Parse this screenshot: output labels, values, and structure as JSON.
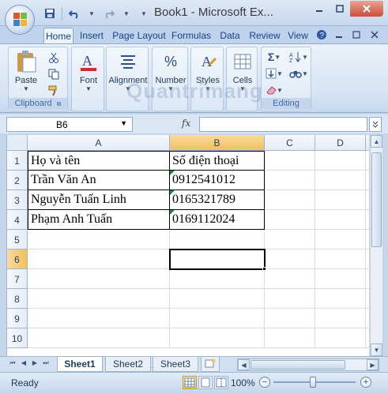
{
  "window": {
    "title": "Book1 - Microsoft Ex...",
    "qat_icons": [
      "save-icon",
      "undo-icon",
      "redo-icon",
      "customize-icon"
    ]
  },
  "ribbon_tabs": [
    "Home",
    "Insert",
    "Page Layout",
    "Formulas",
    "Data",
    "Review",
    "View"
  ],
  "ribbon": {
    "clipboard": {
      "paste": "Paste",
      "group_label": "Clipboard"
    },
    "font": {
      "label": "Font"
    },
    "alignment": {
      "label": "Alignment"
    },
    "number": {
      "label": "Number",
      "icon_glyph": "%"
    },
    "styles": {
      "label": "Styles"
    },
    "cells": {
      "label": "Cells"
    },
    "editing": {
      "group_label": "Editing",
      "sigma": "Σ"
    }
  },
  "watermark": "Quantrimang",
  "formula_bar": {
    "name_box": "B6",
    "fx": "fx",
    "formula": ""
  },
  "columns": [
    "A",
    "B",
    "C",
    "D"
  ],
  "rows": [
    "1",
    "2",
    "3",
    "4",
    "5",
    "6",
    "7",
    "8",
    "9",
    "10"
  ],
  "cells": {
    "A1": "Họ và tên",
    "B1": "Số điện thoại",
    "A2": "Trần Văn An",
    "B2": "0912541012",
    "A3": "Nguyễn Tuấn Linh",
    "B3": "0165321789",
    "A4": "Phạm Anh Tuấn",
    "B4": "0169112024"
  },
  "sheets": [
    "Sheet1",
    "Sheet2",
    "Sheet3"
  ],
  "status": {
    "text": "Ready",
    "zoom": "100%",
    "zoom_out": "−",
    "zoom_in": "+"
  },
  "colors": {
    "accent": "#15428b",
    "selected_header": "#f1c15f",
    "number_text_indicator": "#1c8a3a"
  }
}
